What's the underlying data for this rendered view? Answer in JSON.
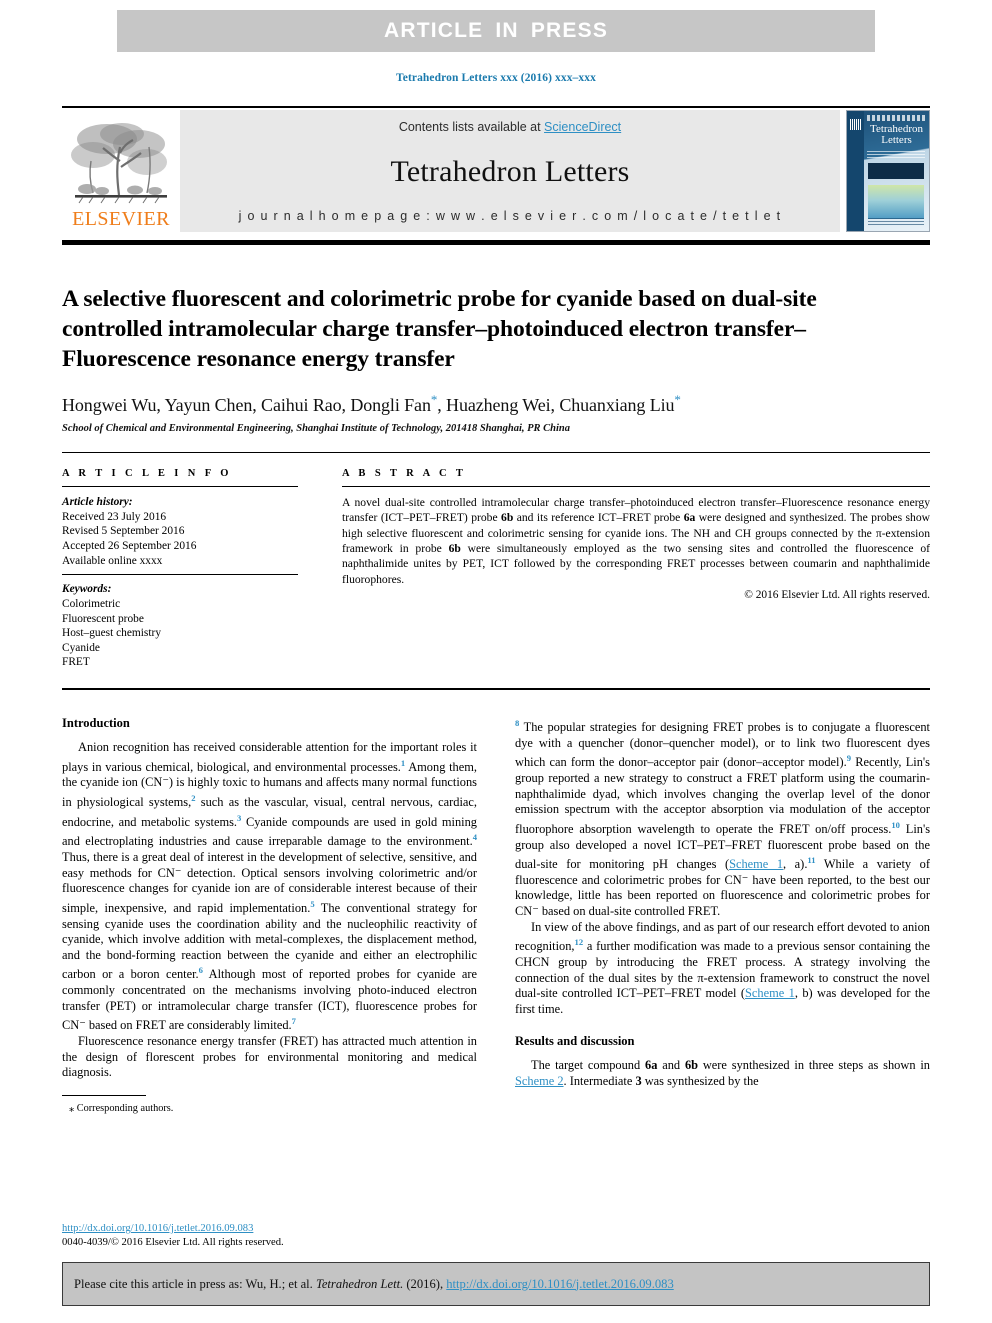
{
  "banner": {
    "label": "ARTICLE  IN  PRESS"
  },
  "running_head": "Tetrahedron Letters xxx (2016) xxx–xxx",
  "masthead": {
    "contents_prefix": "Contents lists available at ",
    "sciencedirect": "ScienceDirect",
    "journal_title": "Tetrahedron Letters",
    "homepage": "j o u r n a l   h o m e p a g e :   w w w . e l s e v i e r . c o m / l o c a t e / t e t l e t",
    "publisher_wordmark": "ELSEVIER",
    "cover_title_line1": "Tetrahedron",
    "cover_title_line2": "Letters"
  },
  "title": "A selective fluorescent and colorimetric probe for cyanide based on dual-site controlled intramolecular charge transfer–photoinduced electron transfer–Fluorescence resonance energy transfer",
  "authors": {
    "pre_star1": "Hongwei Wu, Yayun Chen, Caihui Rao, Dongli Fan",
    "mid": ", Huazheng Wei, Chuanxiang Liu",
    "star": "*"
  },
  "affiliation": "School of Chemical and Environmental Engineering, Shanghai Institute of Technology, 201418 Shanghai, PR China",
  "article_info": {
    "label": "A R T I C L E   I N F O",
    "history_title": "Article history:",
    "history": [
      "Received 23 July 2016",
      "Revised 5 September 2016",
      "Accepted 26 September 2016",
      "Available online xxxx"
    ],
    "keywords_title": "Keywords:",
    "keywords": [
      "Colorimetric",
      "Fluorescent probe",
      "Host–guest chemistry",
      "Cyanide",
      "FRET"
    ]
  },
  "abstract": {
    "label": "A B S T R A C T",
    "text_1": "A novel dual-site controlled intramolecular charge transfer–photoinduced electron transfer–Fluorescence resonance energy transfer (ICT–PET–FRET) probe ",
    "bold_6b_1": "6b",
    "text_2": " and its reference ICT–FRET probe ",
    "bold_6a": "6a",
    "text_3": " were designed and synthesized. The probes show high selective fluorescent and colorimetric sensing for cyanide ions. The NH and CH groups connected by the π-extension framework in probe ",
    "bold_6b_2": "6b",
    "text_4": " were simultaneously employed as the two sensing sites and controlled the fluorescence of naphthalimide unites by PET, ICT followed by the corresponding FRET processes between coumarin and naphthalimide fluorophores.",
    "copyright": "© 2016 Elsevier Ltd. All rights reserved."
  },
  "body": {
    "introduction_heading": "Introduction",
    "intro_p1_a": "Anion recognition has received considerable attention for the important roles it plays in various chemical, biological, and environmental processes.",
    "intro_p1_ref1": "1",
    "intro_p1_b": " Among them, the cyanide ion (CN⁻) is highly toxic to humans and affects many normal functions in physiological systems,",
    "intro_p1_ref2": "2",
    "intro_p1_c": " such as the vascular, visual, central nervous, cardiac, endocrine, and metabolic systems.",
    "intro_p1_ref3": "3",
    "intro_p1_d": " Cyanide compounds are used in gold mining and electroplating industries and cause irreparable damage to the environment.",
    "intro_p1_ref4": "4",
    "intro_p1_e": " Thus, there is a great deal of interest in the development of selective, sensitive, and easy methods for CN⁻ detection. Optical sensors involving colorimetric and/or fluorescence changes for cyanide ion are of considerable interest because of their simple, inexpensive, and rapid implementation.",
    "intro_p1_ref5": "5",
    "intro_p1_f": " The conventional strategy for sensing cyanide uses the coordination ability and the nucleophilic reactivity of cyanide, which involve addition with metal-complexes, the displacement method, and the bond-forming reaction between the cyanide and either an electrophilic carbon or a boron center.",
    "intro_p1_ref6": "6",
    "intro_p1_g": " Although most of reported probes for cyanide are commonly concentrated on the mechanisms involving photo-induced electron transfer (PET) or intramolecular charge transfer (ICT), fluorescence probes for CN⁻ based on FRET are considerably limited.",
    "intro_p1_ref7": "7",
    "intro_p2_a": "Fluorescence resonance energy transfer (FRET) has attracted much attention in the design of florescent probes for environmental monitoring and medical diagnosis.",
    "intro_p2_ref8": "8",
    "intro_p2_b": " The popular strategies for designing FRET probes is to conjugate a fluorescent dye with a quencher (donor–quencher model), or to link two fluorescent dyes which can form the donor–acceptor pair (donor–acceptor model).",
    "intro_p2_ref9": "9",
    "intro_p2_c": " Recently, Lin's group reported a new strategy to construct a FRET platform using the coumarin-naphthalimide dyad, which involves changing the overlap level of the donor emission spectrum with the acceptor absorption via modulation of the acceptor fluorophore absorption wavelength to operate the FRET on/off process.",
    "intro_p2_ref10": "10",
    "intro_p2_d": " Lin's group also developed a novel ICT–PET–FRET fluorescent probe based on the dual-site for monitoring pH changes (",
    "scheme1_link_a": "Scheme 1",
    "intro_p2_e": ", a).",
    "intro_p2_ref11": "11",
    "intro_p2_f": " While a variety of fluorescence and colorimetric probes for CN⁻ have been reported, to the best our knowledge, little has been reported on fluorescence and colorimetric probes for CN⁻ based on dual-site controlled FRET.",
    "intro_p3_a": "In view of the above findings, and as part of our research effort devoted to anion recognition,",
    "intro_p3_ref12": "12",
    "intro_p3_b": " a further modification was made to a previous sensor containing the CHCN group by introducing the FRET process. A strategy involving the connection of the dual sites by the π-extension framework to construct the novel dual-site controlled ICT–PET–FRET model (",
    "scheme1_link_b": "Scheme 1",
    "intro_p3_c": ", b) was developed for the first time.",
    "results_heading": "Results and discussion",
    "results_p1_a": "The target compound ",
    "results_bold_6a": "6a",
    "results_p1_b": " and ",
    "results_bold_6b": "6b",
    "results_p1_c": " were synthesized in three steps as shown in ",
    "scheme2_link": "Scheme 2",
    "results_p1_d": ". Intermediate ",
    "results_bold_3": "3",
    "results_p1_e": " was synthesized by the"
  },
  "footnote": "⁎  Corresponding authors.",
  "doi_block": {
    "doi_url": "http://dx.doi.org/10.1016/j.tetlet.2016.09.083",
    "issn_line": "0040-4039/© 2016 Elsevier Ltd. All rights reserved."
  },
  "citation_footer": {
    "prefix": "Please cite this article in press as: Wu, H.; et al. ",
    "journal_italic": "Tetrahedron Lett.",
    "year": " (2016), ",
    "doi": "http://dx.doi.org/10.1016/j.tetlet.2016.09.083"
  },
  "colors": {
    "banner_bg": "#c6c6c6",
    "link_blue": "#2e8fc4",
    "running_head_blue": "#1a7aad",
    "elsevier_orange": "#ef7d1a",
    "masthead_grey": "#e8e8e8",
    "footer_grey": "#c4c4c4"
  }
}
